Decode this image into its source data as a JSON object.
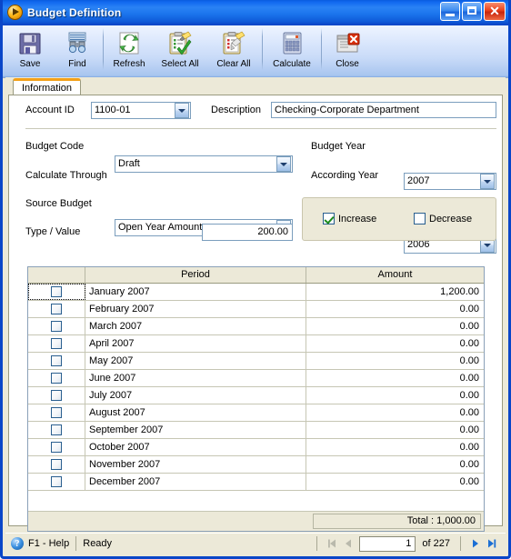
{
  "window": {
    "title": "Budget Definition",
    "title_icon": "orange-play-circle-icon",
    "minimize_label": "_",
    "maximize_label": "□",
    "close_label": "✕"
  },
  "toolbar": {
    "items": [
      {
        "label": "Save",
        "icon": "floppy-disk-save-icon"
      },
      {
        "label": "Find",
        "icon": "binoculars-find-icon"
      },
      {
        "label": "Refresh",
        "icon": "green-refresh-arrows-icon"
      },
      {
        "label": "Select All",
        "icon": "clipboard-check-icon"
      },
      {
        "label": "Clear All",
        "icon": "clipboard-eraser-icon"
      },
      {
        "label": "Calculate",
        "icon": "calculator-icon"
      },
      {
        "label": "Close",
        "icon": "window-close-icon"
      }
    ]
  },
  "tabs": [
    {
      "label": "Information",
      "active": true
    }
  ],
  "form": {
    "account_id": {
      "label": "Account ID",
      "value": "1100-01"
    },
    "description": {
      "label": "Description",
      "value": "Checking-Corporate Department"
    },
    "budget_code": {
      "label": "Budget Code",
      "value": "Draft"
    },
    "calculate_through": {
      "label": "Calculate Through",
      "value": "Open Year Amount"
    },
    "source_budget": {
      "label": "Source Budget",
      "value": "",
      "disabled": true
    },
    "type_value": {
      "label": "Type / Value",
      "type_value": "Amount",
      "type_disabled": true,
      "amount": "200.00"
    },
    "budget_year": {
      "label": "Budget Year",
      "value": "2007"
    },
    "according_year": {
      "label": "According Year",
      "value": "2006"
    },
    "increase": {
      "label": "Increase",
      "checked": true
    },
    "decrease": {
      "label": "Decrease",
      "checked": false
    }
  },
  "grid": {
    "columns": [
      "",
      "Period",
      "Amount"
    ],
    "rows": [
      {
        "checked": false,
        "period": "January 2007",
        "amount": "1,200.00",
        "focus": true
      },
      {
        "checked": false,
        "period": "February 2007",
        "amount": "0.00"
      },
      {
        "checked": false,
        "period": "March 2007",
        "amount": "0.00"
      },
      {
        "checked": false,
        "period": "April 2007",
        "amount": "0.00"
      },
      {
        "checked": false,
        "period": "May 2007",
        "amount": "0.00"
      },
      {
        "checked": false,
        "period": "June 2007",
        "amount": "0.00"
      },
      {
        "checked": false,
        "period": "July 2007",
        "amount": "0.00"
      },
      {
        "checked": false,
        "period": "August 2007",
        "amount": "0.00"
      },
      {
        "checked": false,
        "period": "September 2007",
        "amount": "0.00"
      },
      {
        "checked": false,
        "period": "October 2007",
        "amount": "0.00"
      },
      {
        "checked": false,
        "period": "November 2007",
        "amount": "0.00"
      },
      {
        "checked": false,
        "period": "December 2007",
        "amount": "0.00"
      }
    ],
    "total_label": "Total : 1,000.00"
  },
  "statusbar": {
    "help": "F1 - Help",
    "status": "Ready",
    "page_value": "1",
    "of_text": "of  227",
    "first_icon": "first-record-icon",
    "prev_icon": "previous-record-icon",
    "next_icon": "next-record-icon",
    "last_icon": "last-record-icon"
  },
  "colors": {
    "titlebar_blue": "#1068ef",
    "frame_blue": "#0a46c8",
    "panel_beige": "#ece9d8",
    "tab_accent_orange": "#f3a017",
    "close_red": "#e9401a"
  }
}
